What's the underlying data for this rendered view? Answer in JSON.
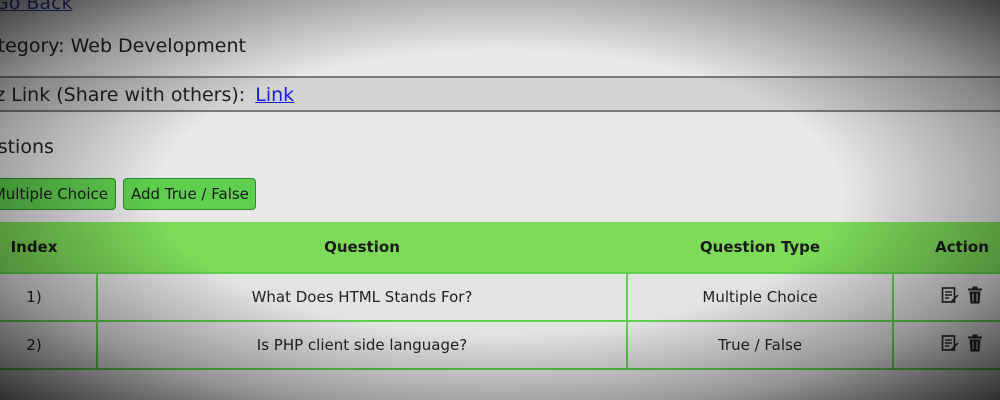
{
  "nav": {
    "go_back_label": "Go Back"
  },
  "category": {
    "text": "ategory: Web Development"
  },
  "quiz_link": {
    "label": "iz Link (Share with others):",
    "link_text": "Link"
  },
  "questions": {
    "title": "estions"
  },
  "buttons": {
    "add_multiple_choice": "Multiple Choice",
    "add_true_false": "Add True / False"
  },
  "table": {
    "headers": {
      "index": "Index",
      "question": "Question",
      "type": "Question Type",
      "action": "Action"
    },
    "rows": [
      {
        "index": "1)",
        "question": "What Does HTML Stands For?",
        "type": "Multiple Choice"
      },
      {
        "index": "2)",
        "question": "Is PHP client side language?",
        "type": "True / False"
      }
    ]
  },
  "icons": [
    "edit-icon",
    "trash-icon"
  ],
  "colors": {
    "header_green": "#7ddb59",
    "button_green": "#5fcf4f",
    "link_blue": "#1a1ae0"
  }
}
